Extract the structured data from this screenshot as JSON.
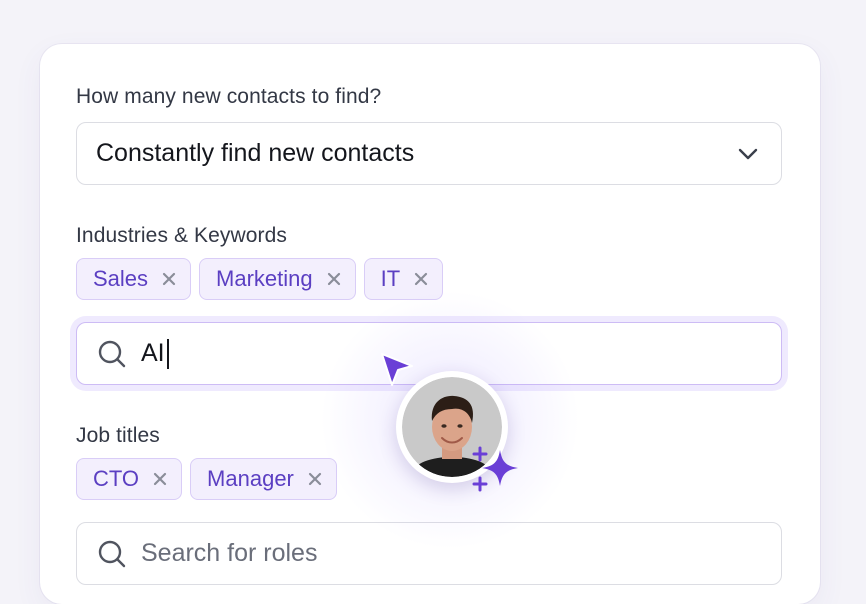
{
  "form": {
    "contacts_label": "How many new contacts to find?",
    "contacts_select_value": "Constantly find new contacts",
    "industries_label": "Industries & Keywords",
    "industry_tags": [
      "Sales",
      "Marketing",
      "IT"
    ],
    "industry_search_value": "AI",
    "job_titles_label": "Job titles",
    "job_title_tags": [
      "CTO",
      "Manager"
    ],
    "roles_search_placeholder": "Search for roles"
  },
  "icons": {
    "select": "chevron-down-icon",
    "tag_remove": "close-icon",
    "search": "search-icon",
    "cursor": "pointer-cursor-icon",
    "sparkle": "sparkle-icon"
  },
  "colors": {
    "accent": "#5b3fc2",
    "tag_bg": "#f3effd",
    "tag_border": "#d9cdf7",
    "sparkle": "#6a3fd6"
  }
}
